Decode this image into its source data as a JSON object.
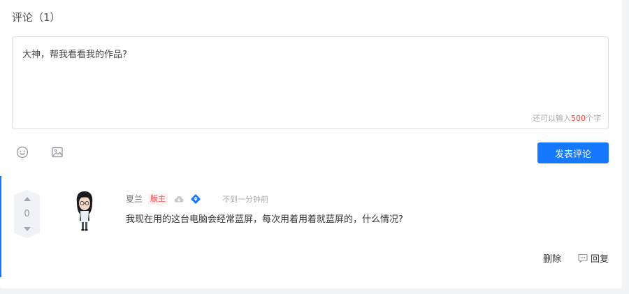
{
  "comments_section": {
    "title": "评论（1）"
  },
  "editor": {
    "text": "大神，帮我看看我的作品?",
    "counter_prefix": "还可以输入",
    "counter_number": "500",
    "counter_suffix": "个字"
  },
  "toolbar": {
    "emoji_icon": "smiley-icon",
    "image_icon": "image-icon",
    "submit_label": "发表评论"
  },
  "comment": {
    "vote_count": "0",
    "author": "夏兰",
    "role": "版主",
    "badges": [
      "cloud-icon",
      "diamond-badge-icon"
    ],
    "time": "不到一分钟前",
    "text": "我现在用的这台电脑会经常蓝屏，每次用着用着就蓝屏的，什么情况?",
    "actions": {
      "delete_label": "删除",
      "reply_label": "回复"
    }
  },
  "colors": {
    "accent": "#1677ff",
    "role_badge": "#ff4d4f",
    "counter_number": "#ff3b30"
  }
}
